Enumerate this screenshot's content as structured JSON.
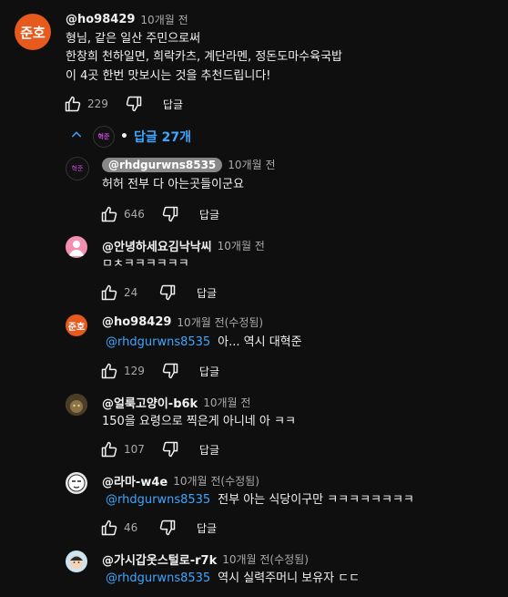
{
  "main_comment": {
    "avatar_text": "준호",
    "handle": "@ho98429",
    "time": "10개월 전",
    "lines": [
      "형님, 같은 일산 주민으로써",
      "한창희 천하일면, 희락카츠, 계단라멘, 정돈도마수육국밥",
      "이 4곳 한번 맛보시는 것을 추천드립니다!"
    ],
    "likes": "229",
    "reply_label": "답글"
  },
  "replies_toggle": {
    "avatar_text": "혁준",
    "label": "답글 27개"
  },
  "replies": [
    {
      "avatar_text": "혁준",
      "handle": "@rhdgurwns8535",
      "time": "10개월 전",
      "mention": "",
      "text": "허허 전부 다 아는곳들이군요",
      "likes": "646",
      "reply_label": "답글"
    },
    {
      "handle": "@안녕하세요김낙낙씨",
      "time": "10개월 전",
      "mention": "",
      "text": "ㅁㅊㅋㅋㅋㅋㅋㅋ",
      "likes": "24",
      "reply_label": "답글"
    },
    {
      "avatar_text": "준호",
      "handle": "@ho98429",
      "time": "10개월 전(수정됨)",
      "mention": "@rhdgurwns8535",
      "text": "아... 역시 대혁준",
      "likes": "129",
      "reply_label": "답글"
    },
    {
      "handle": "@얼룩고양이-b6k",
      "time": "10개월 전",
      "mention": "",
      "text": "150을 요령으로 찍은게 아니네 아 ㅋㅋ",
      "likes": "107",
      "reply_label": "답글"
    },
    {
      "handle": "@라마-w4e",
      "time": "10개월 전(수정됨)",
      "mention": "@rhdgurwns8535",
      "text": "전부 아는 식당이구만 ㅋㅋㅋㅋㅋㅋㅋㅋ",
      "likes": "46",
      "reply_label": "답글"
    },
    {
      "handle": "@가시갑옷스털로-r7k",
      "time": "10개월 전(수정됨)",
      "mention": "@rhdgurwns8535",
      "text": "역시 실력주머니 보유자 ㄷㄷ",
      "likes": "",
      "reply_label": ""
    }
  ],
  "icons": {
    "like": "thumbs-up-icon",
    "dislike": "thumbs-down-icon",
    "collapse": "chevron-up-icon"
  },
  "colors": {
    "background": "#0f0f0f",
    "link": "#3ea6ff",
    "secondary_text": "#aaaaaa",
    "avatar_orange": "#e65a1e"
  }
}
